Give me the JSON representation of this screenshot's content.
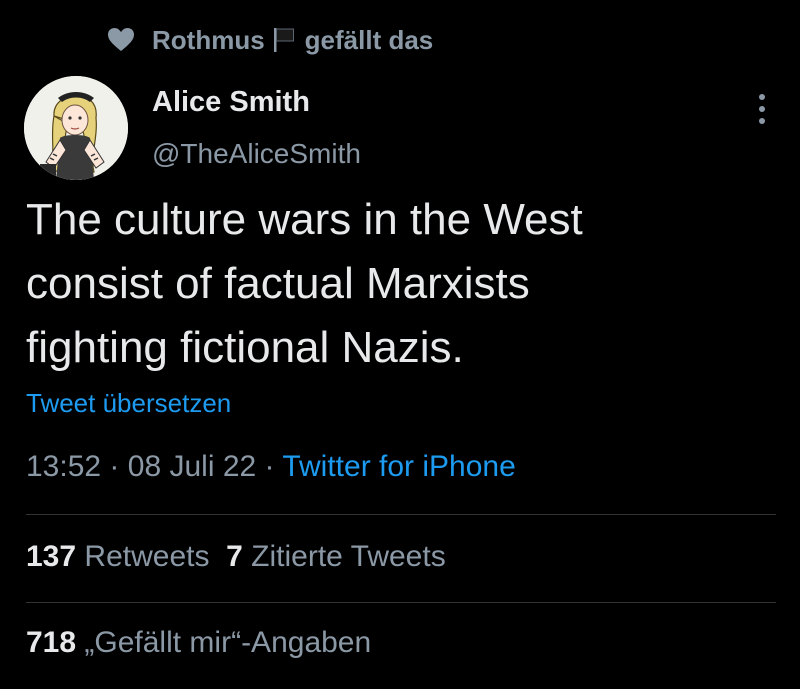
{
  "social_context": {
    "icon": "heart-icon",
    "user": "Rothmus",
    "flag_icon": "black-flag-icon",
    "action": "gefällt das"
  },
  "author": {
    "name": "Alice Smith",
    "handle": "@TheAliceSmith",
    "avatar_icon": "avatar-alice-illustration"
  },
  "tweet": {
    "lines": [
      "The culture wars in the West",
      "consist of factual Marxists",
      "fighting fictional Nazis."
    ],
    "translate": "Tweet übersetzen"
  },
  "meta": {
    "time": "13:52",
    "sep1": "·",
    "date": "08 Juli 22",
    "sep2": "·",
    "source": "Twitter for iPhone"
  },
  "stats": {
    "retweets_count": "137",
    "retweets_label": "Retweets",
    "quotes_count": "7",
    "quotes_label": "Zitierte Tweets",
    "likes_count": "718",
    "likes_label": "„Gefällt mir“-Angaben"
  },
  "colors": {
    "background": "#000000",
    "text_primary": "#e7e9ea",
    "text_secondary": "#8b98a5",
    "link": "#1d9bf0",
    "divider": "#2f3336"
  }
}
